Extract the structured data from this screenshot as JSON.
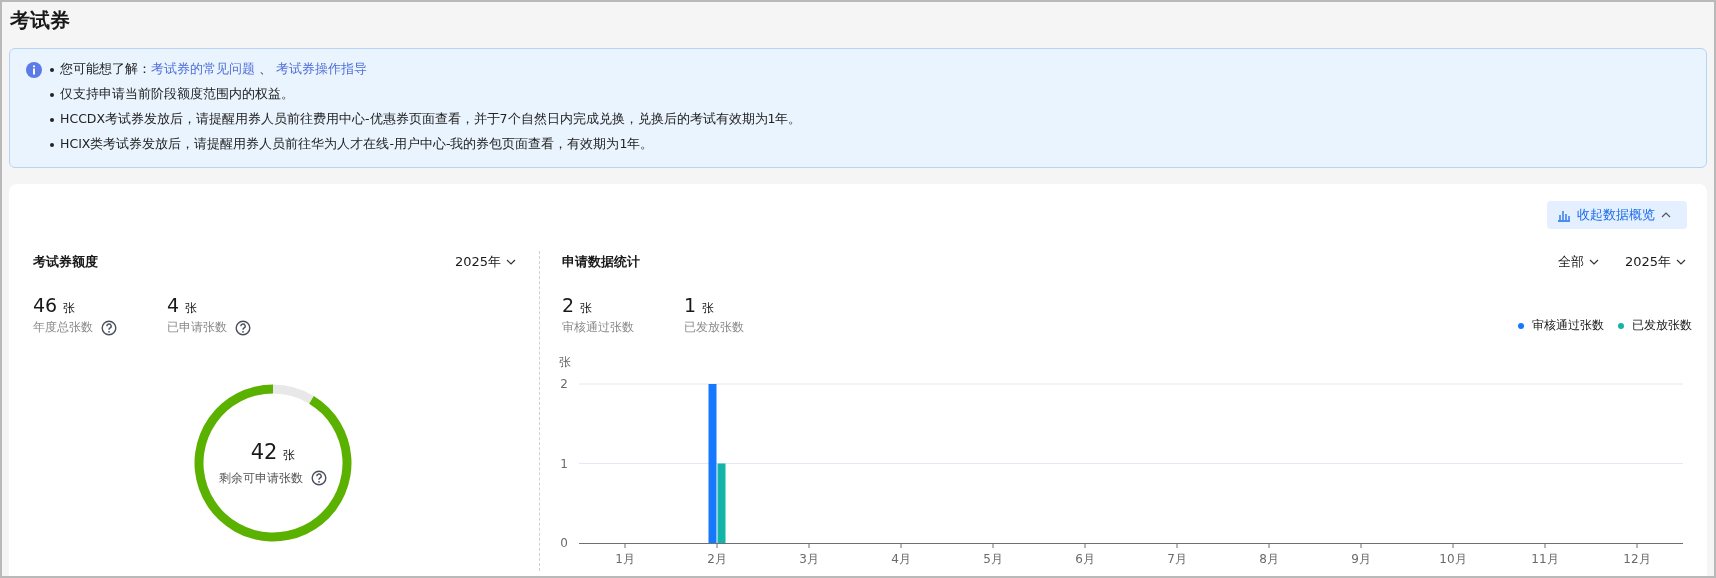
{
  "page_title": "考试券",
  "notice": {
    "items": [
      {
        "kind": "links",
        "lead": "您可能想了解：",
        "links": [
          "考试券的常见问题",
          "考试券操作指导"
        ],
        "separator": "、"
      },
      {
        "kind": "text",
        "text": "仅支持申请当前阶段额度范围内的权益。"
      },
      {
        "kind": "text",
        "text": "HCCDX考试券发放后，请提醒用券人员前往费用中心-优惠券页面查看，并于7个自然日内完成兑换，兑换后的考试有效期为1年。"
      },
      {
        "kind": "text",
        "text": "HCIX类考试券发放后，请提醒用券人员前往华为人才在线-用户中心-我的券包页面查看，有效期为1年。"
      }
    ]
  },
  "collapse_button": {
    "label": "收起数据概览"
  },
  "quota": {
    "title": "考试券额度",
    "year": "2025年",
    "stats": [
      {
        "value": "46",
        "unit": "张",
        "label": "年度总张数",
        "help": true
      },
      {
        "value": "4",
        "unit": "张",
        "label": "已申请张数",
        "help": true
      }
    ],
    "donut": {
      "value": "42",
      "unit": "张",
      "label": "剩余可申请张数",
      "help": true,
      "chart_data": {
        "type": "donut",
        "values": [
          8.7,
          91.3
        ]
      }
    }
  },
  "applications": {
    "title": "申请数据统计",
    "filter": "全部",
    "year": "2025年",
    "stats": [
      {
        "value": "2",
        "unit": "张",
        "label": "审核通过张数",
        "help": false
      },
      {
        "value": "1",
        "unit": "张",
        "label": "已发放张数",
        "help": false
      }
    ],
    "chart_data": {
      "type": "bar",
      "ylabel": "张",
      "categories": [
        "1月",
        "2月",
        "3月",
        "4月",
        "5月",
        "6月",
        "7月",
        "8月",
        "9月",
        "10月",
        "11月",
        "12月"
      ],
      "series": [
        {
          "name": "审核通过张数",
          "color": "#1677ff",
          "values": [
            0,
            2,
            0,
            0,
            0,
            0,
            0,
            0,
            0,
            0,
            0,
            0
          ]
        },
        {
          "name": "已发放张数",
          "color": "#13b5a8",
          "values": [
            0,
            1,
            0,
            0,
            0,
            0,
            0,
            0,
            0,
            0,
            0,
            0
          ]
        }
      ],
      "ylim": [
        0,
        2
      ],
      "yticks": [
        0,
        1,
        2
      ]
    }
  }
}
